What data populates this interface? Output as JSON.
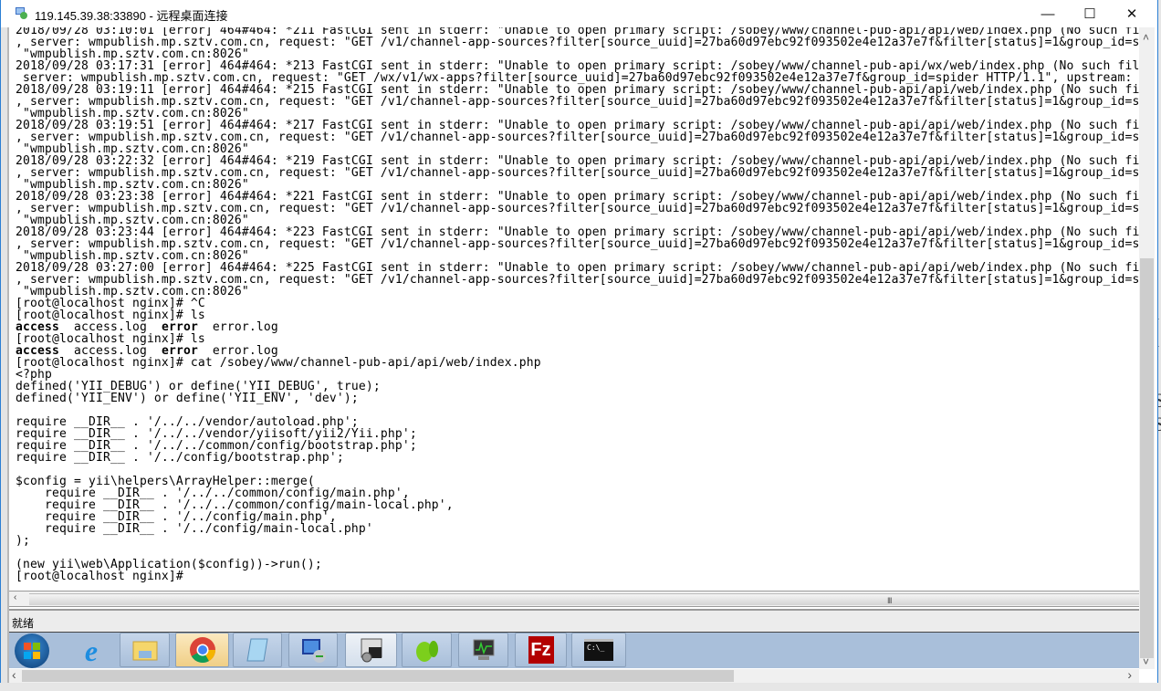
{
  "window": {
    "title": "119.145.39.38:33890 - 远程桌面连接",
    "minimize_glyph": "—",
    "maximize_glyph": "☐",
    "close_glyph": "✕"
  },
  "terminal": {
    "lines": [
      "2018/09/28 03:10:01 [error] 464#464: *211 FastCGI sent in stderr: \"Unable to open primary script: /sobey/www/channel-pub-api/api/web/index.php (No such fi",
      ", server: wmpublish.mp.sztv.com.cn, request: \"GET /v1/channel-app-sources?filter[source_uuid]=27ba60d97ebc92f093502e4e12a37e7f&filter[status]=1&group_id=s",
      " \"wmpublish.mp.sztv.com.cn:8026\"",
      "2018/09/28 03:17:31 [error] 464#464: *213 FastCGI sent in stderr: \"Unable to open primary script: /sobey/www/channel-pub-api/wx/web/index.php (No such fil",
      " server: wmpublish.mp.sztv.com.cn, request: \"GET /wx/v1/wx-apps?filter[source_uuid]=27ba60d97ebc92f093502e4e12a37e7f&group_id=spider HTTP/1.1\", upstream: ",
      "2018/09/28 03:19:11 [error] 464#464: *215 FastCGI sent in stderr: \"Unable to open primary script: /sobey/www/channel-pub-api/api/web/index.php (No such fi",
      ", server: wmpublish.mp.sztv.com.cn, request: \"GET /v1/channel-app-sources?filter[source_uuid]=27ba60d97ebc92f093502e4e12a37e7f&filter[status]=1&group_id=s",
      " \"wmpublish.mp.sztv.com.cn:8026\"",
      "2018/09/28 03:19:51 [error] 464#464: *217 FastCGI sent in stderr: \"Unable to open primary script: /sobey/www/channel-pub-api/api/web/index.php (No such fi",
      ", server: wmpublish.mp.sztv.com.cn, request: \"GET /v1/channel-app-sources?filter[source_uuid]=27ba60d97ebc92f093502e4e12a37e7f&filter[status]=1&group_id=s",
      " \"wmpublish.mp.sztv.com.cn:8026\"",
      "2018/09/28 03:22:32 [error] 464#464: *219 FastCGI sent in stderr: \"Unable to open primary script: /sobey/www/channel-pub-api/api/web/index.php (No such fi",
      ", server: wmpublish.mp.sztv.com.cn, request: \"GET /v1/channel-app-sources?filter[source_uuid]=27ba60d97ebc92f093502e4e12a37e7f&filter[status]=1&group_id=s",
      " \"wmpublish.mp.sztv.com.cn:8026\"",
      "2018/09/28 03:23:38 [error] 464#464: *221 FastCGI sent in stderr: \"Unable to open primary script: /sobey/www/channel-pub-api/api/web/index.php (No such fi",
      ", server: wmpublish.mp.sztv.com.cn, request: \"GET /v1/channel-app-sources?filter[source_uuid]=27ba60d97ebc92f093502e4e12a37e7f&filter[status]=1&group_id=s",
      " \"wmpublish.mp.sztv.com.cn:8026\"",
      "2018/09/28 03:23:44 [error] 464#464: *223 FastCGI sent in stderr: \"Unable to open primary script: /sobey/www/channel-pub-api/api/web/index.php (No such fi",
      ", server: wmpublish.mp.sztv.com.cn, request: \"GET /v1/channel-app-sources?filter[source_uuid]=27ba60d97ebc92f093502e4e12a37e7f&filter[status]=1&group_id=s",
      " \"wmpublish.mp.sztv.com.cn:8026\"",
      "2018/09/28 03:27:00 [error] 464#464: *225 FastCGI sent in stderr: \"Unable to open primary script: /sobey/www/channel-pub-api/api/web/index.php (No such fi",
      ", server: wmpublish.mp.sztv.com.cn, request: \"GET /v1/channel-app-sources?filter[source_uuid]=27ba60d97ebc92f093502e4e12a37e7f&filter[status]=1&group_id=s",
      " \"wmpublish.mp.sztv.com.cn:8026\"",
      "[root@localhost nginx]# ^C",
      "[root@localhost nginx]# ls"
    ],
    "ls_output_1": {
      "dir1": "access",
      "gap1": "  access.log  ",
      "dir2": "error",
      "gap2": "  error.log"
    },
    "prompt_ls_2": "[root@localhost nginx]# ls",
    "ls_output_2": {
      "dir1": "access",
      "gap1": "  access.log  ",
      "dir2": "error",
      "gap2": "  error.log"
    },
    "code_lines": [
      "[root@localhost nginx]# cat /sobey/www/channel-pub-api/api/web/index.php",
      "<?php",
      "defined('YII_DEBUG') or define('YII_DEBUG', true);",
      "defined('YII_ENV') or define('YII_ENV', 'dev');",
      "",
      "require __DIR__ . '/../../vendor/autoload.php';",
      "require __DIR__ . '/../../vendor/yiisoft/yii2/Yii.php';",
      "require __DIR__ . '/../../common/config/bootstrap.php';",
      "require __DIR__ . '/../config/bootstrap.php';",
      "",
      "$config = yii\\helpers\\ArrayHelper::merge(",
      "    require __DIR__ . '/../../common/config/main.php',",
      "    require __DIR__ . '/../../common/config/main-local.php',",
      "    require __DIR__ . '/../config/main.php',",
      "    require __DIR__ . '/../config/main-local.php'",
      ");",
      "",
      "(new yii\\web\\Application($config))->run();",
      "[root@localhost nginx]# "
    ]
  },
  "statusbar": {
    "text": "就绪"
  },
  "taskbar": {
    "items": [
      "start-orb",
      "internet-explorer",
      "file-explorer",
      "chrome",
      "notepad",
      "remote-desktop",
      "security-tool",
      "green-app",
      "system-monitor",
      "filezilla",
      "command-prompt"
    ],
    "cmd_label": "C:\\_",
    "filezilla_label": "Fz"
  },
  "scroll": {
    "grip": "III",
    "left": "‹",
    "right": "›",
    "up": "˄",
    "down": "˅"
  },
  "background_letters": [
    "i",
    "i",
    "S",
    "S"
  ],
  "colors": {
    "taskbar": "#a9bfda",
    "border": "#2b7fd4"
  }
}
